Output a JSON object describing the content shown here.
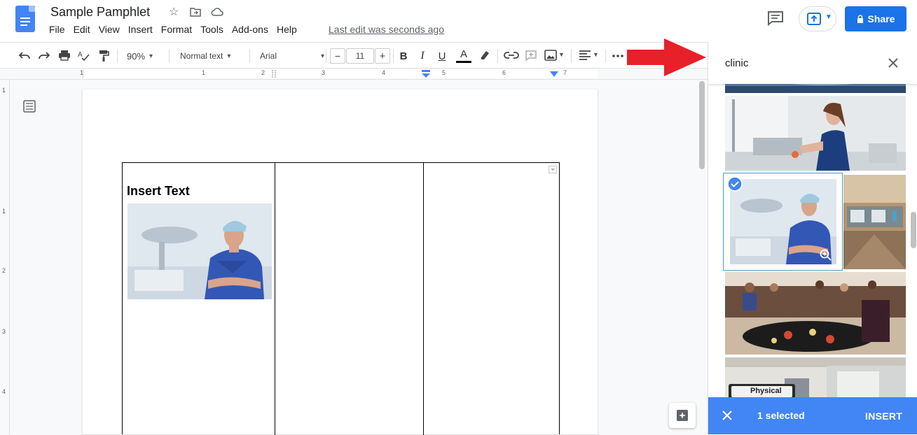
{
  "header": {
    "doc_title": "Sample Pamphlet",
    "menu": [
      "File",
      "Edit",
      "View",
      "Insert",
      "Format",
      "Tools",
      "Add-ons",
      "Help"
    ],
    "last_edit": "Last edit was seconds ago",
    "share_label": "Share"
  },
  "toolbar": {
    "zoom": "90%",
    "style": "Normal text",
    "font": "Arial",
    "font_size": "11",
    "minus": "−",
    "plus": "+",
    "bold": "B",
    "italic": "I",
    "underline": "U",
    "text_color": "A"
  },
  "ruler": {
    "h_numbers": [
      "1",
      "1",
      "2",
      "3",
      "4",
      "5",
      "6",
      "7"
    ],
    "v_numbers": [
      "1",
      "1",
      "2",
      "3",
      "4"
    ]
  },
  "document": {
    "cell_heading": "Insert Text"
  },
  "panel": {
    "search_query": "clinic",
    "selected_count": "1 selected",
    "insert_label": "INSERT"
  },
  "images": {
    "physical_sign": "Physical"
  },
  "colors": {
    "accent": "#1a73e8",
    "panel_bar": "#4285f4",
    "arrow": "#e8202a"
  }
}
